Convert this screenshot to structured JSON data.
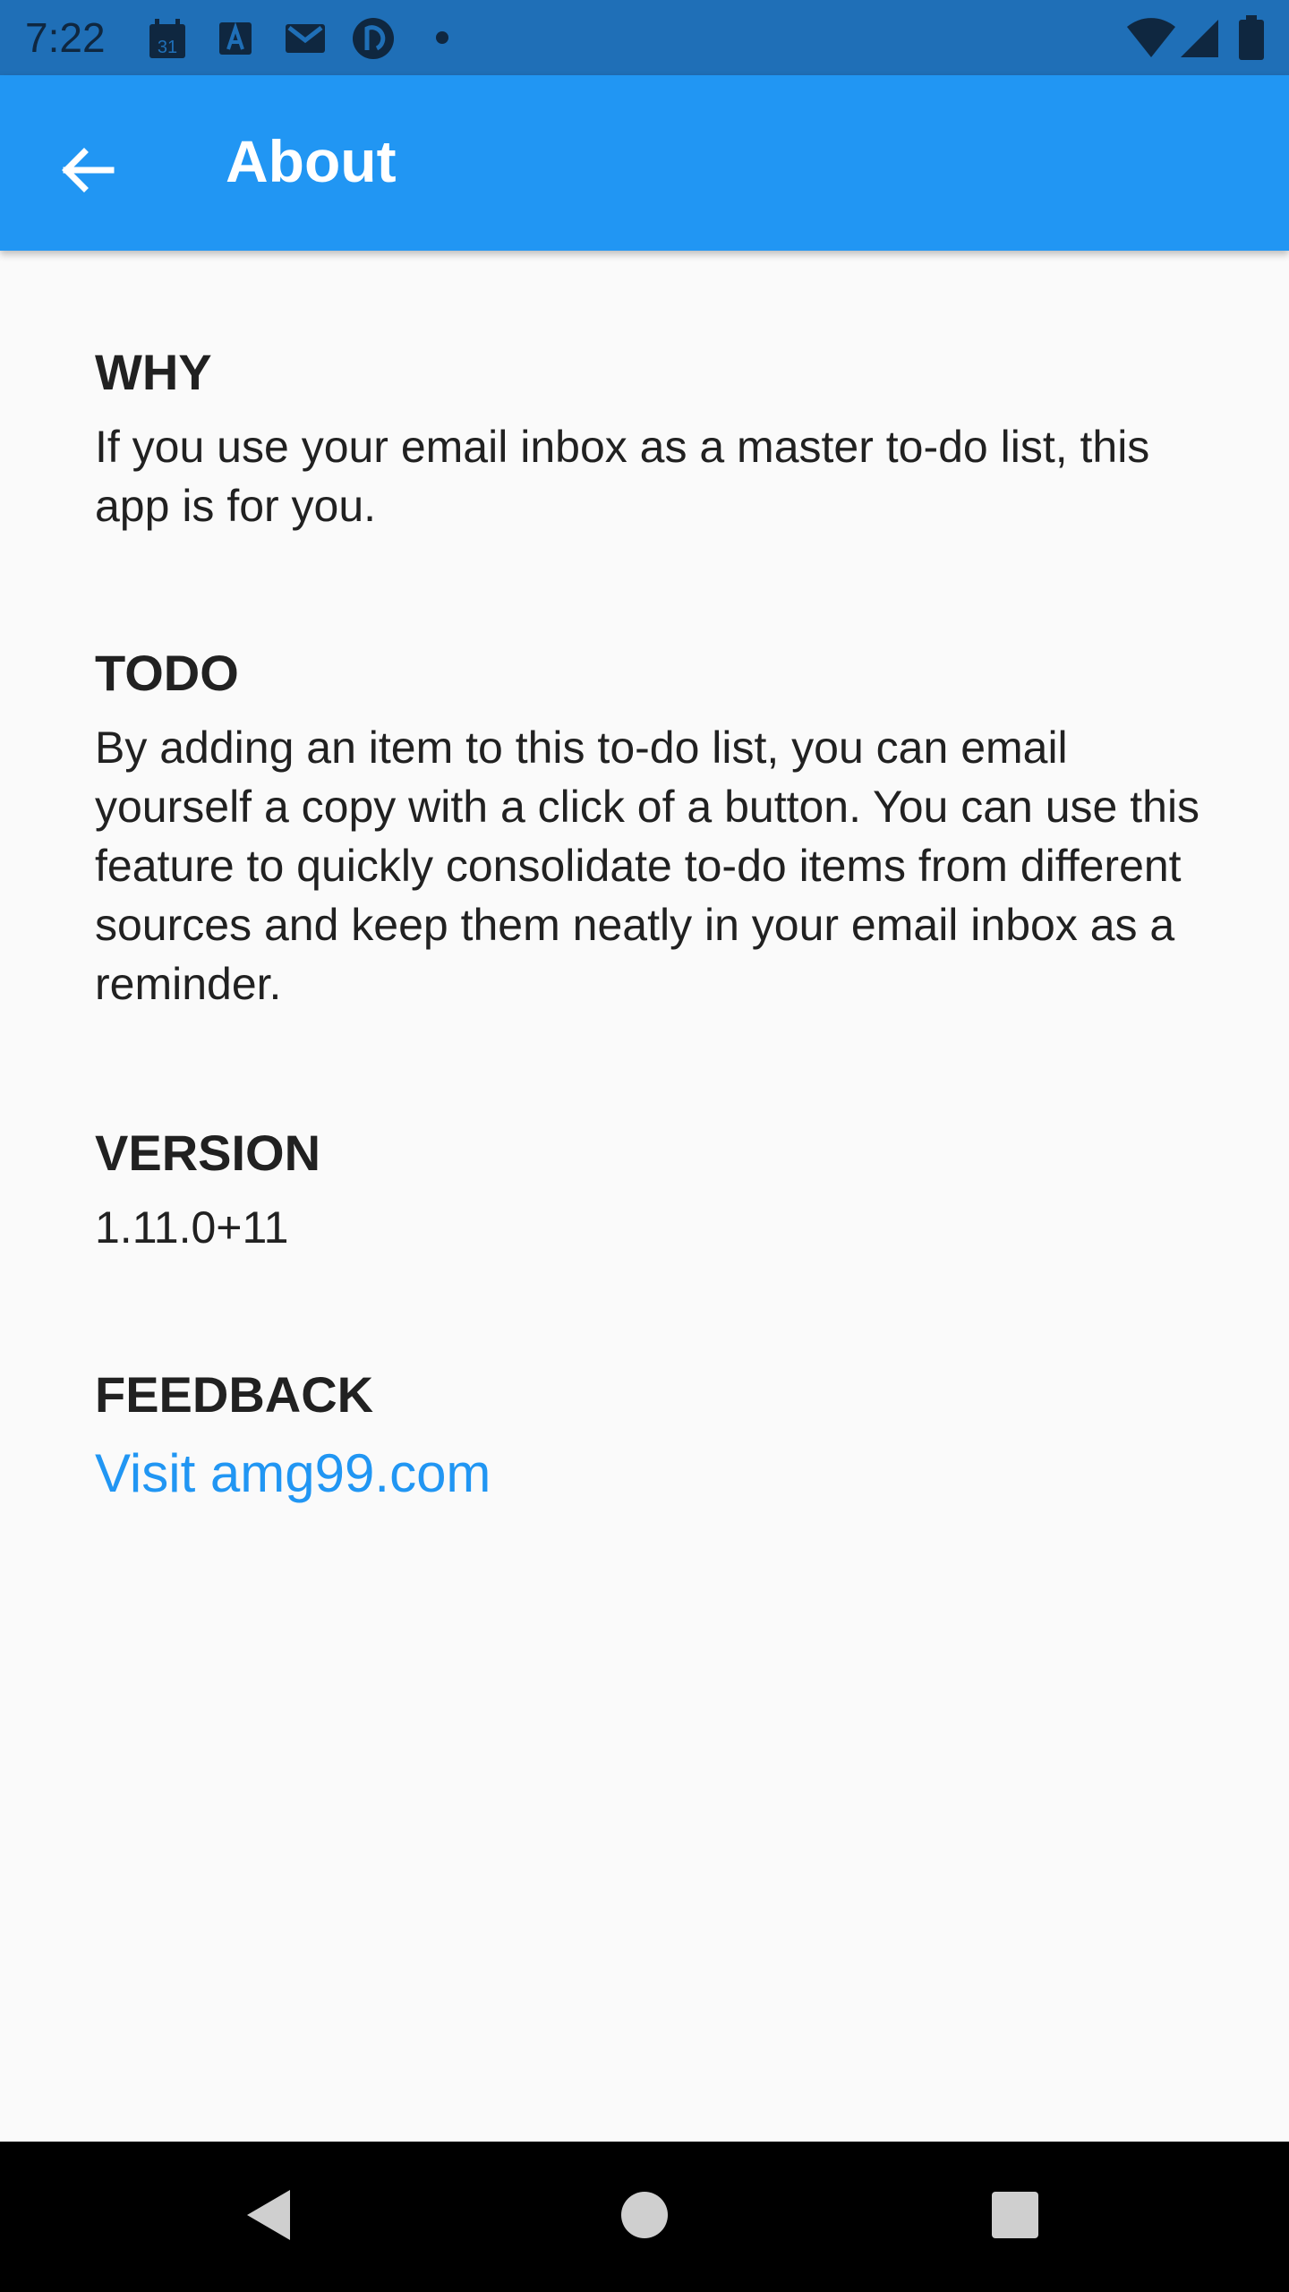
{
  "status_bar": {
    "time": "7:22",
    "icons": [
      "calendar-icon",
      "font-a-icon",
      "gmail-icon",
      "pocket-casts-icon",
      "notification-dot-icon",
      "wifi-icon",
      "cell-signal-icon",
      "battery-icon"
    ],
    "calendar_day": "31",
    "color": "#1f6fb7"
  },
  "app_bar": {
    "title": "About",
    "back_icon": "arrow-back-icon",
    "color": "#2196f3"
  },
  "sections": {
    "why": {
      "title": "WHY",
      "body": "If you use your email inbox as a master to-do list, this app is for you."
    },
    "todo": {
      "title": "TODO",
      "body": "By adding an item to this to-do list, you can email yourself a copy with a click of a button.  You can use this feature to quickly consolidate to-do items from different sources and keep them neatly in your email inbox as a reminder."
    },
    "version": {
      "title": "VERSION",
      "body": "1.11.0+11"
    },
    "feedback": {
      "title": "FEEDBACK",
      "link_text": "Visit amg99.com",
      "link_color": "#2196f3"
    }
  },
  "nav_bar": {
    "buttons": [
      "nav-back-icon",
      "nav-home-icon",
      "nav-recents-icon"
    ]
  }
}
